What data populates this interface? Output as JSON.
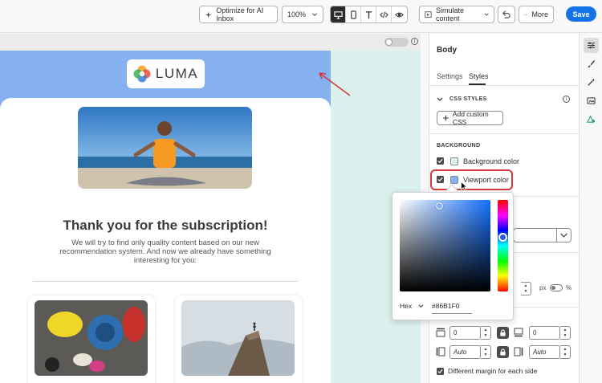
{
  "toolbar": {
    "optimize_label": "Optimize for AI Inbox",
    "zoom_value": "100%",
    "simulate_label": "Simulate content",
    "more_label": "More",
    "save_label": "Save"
  },
  "email": {
    "logo_text": "LUMA",
    "title": "Thank you for the subscription!",
    "body": "We will try to find only quality content based on our new recommendation system. And now we already have something interesting for you:"
  },
  "panel": {
    "title": "Body",
    "tabs": [
      {
        "label": "Settings",
        "active": false
      },
      {
        "label": "Styles",
        "active": true
      }
    ],
    "css_styles_heading": "CSS STYLES",
    "add_css_label": "Add custom CSS",
    "background_heading": "BACKGROUND",
    "background_color_label": "Background color",
    "viewport_color_label": "Viewport color",
    "unit_px": "px",
    "unit_pct": "%",
    "margin_top": "0",
    "margin_bottom": "0",
    "margin_left": "Auto",
    "margin_right": "Auto",
    "diff_margin_label": "Different margin for each side"
  },
  "color_picker": {
    "mode": "Hex",
    "hex_value": "#86B1F0"
  },
  "colors": {
    "viewport": "#86B1F0",
    "background": "#DBF1EE",
    "accent": "#1473E6",
    "highlight": "#D7373F"
  }
}
